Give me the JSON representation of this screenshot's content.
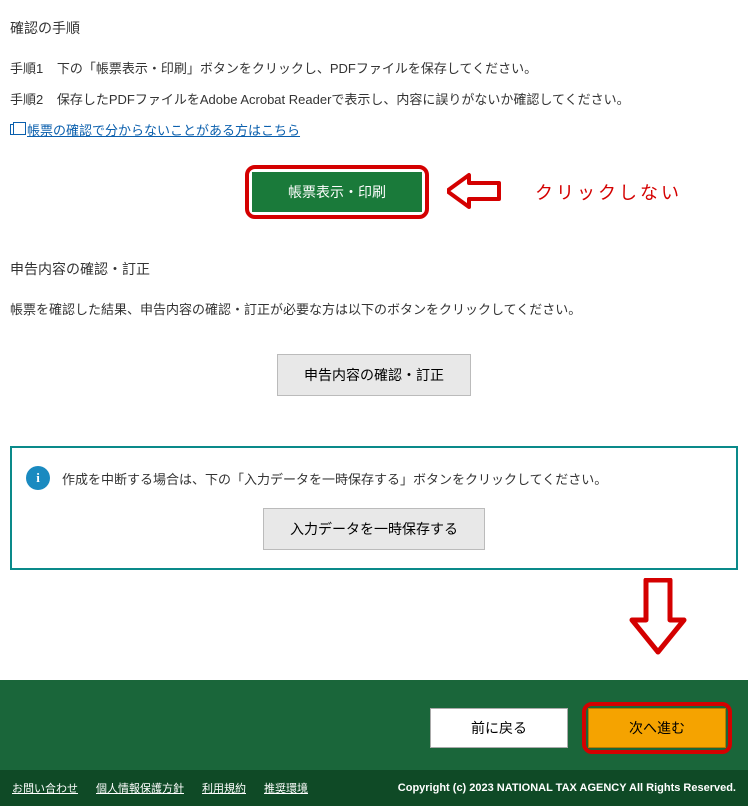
{
  "section1": {
    "title": "確認の手順",
    "step1_label": "手順1",
    "step1_text": "下の「帳票表示・印刷」ボタンをクリックし、PDFファイルを保存してください。",
    "step2_label": "手順2",
    "step2_text": "保存したPDFファイルをAdobe Acrobat Readerで表示し、内容に誤りがないか確認してください。",
    "help_link": "帳票の確認で分からないことがある方はこちら",
    "print_button": "帳票表示・印刷",
    "red_note": "クリックしない"
  },
  "section2": {
    "title": "申告内容の確認・訂正",
    "desc": "帳票を確認した結果、申告内容の確認・訂正が必要な方は以下のボタンをクリックしてください。",
    "button": "申告内容の確認・訂正"
  },
  "info_box": {
    "icon": "i",
    "text": "作成を中断する場合は、下の「入力データを一時保存する」ボタンをクリックしてください。",
    "button": "入力データを一時保存する"
  },
  "nav": {
    "back": "前に戻る",
    "next": "次へ進む"
  },
  "footer": {
    "links": [
      "お問い合わせ",
      "個人情報保護方針",
      "利用規約",
      "推奨環境"
    ],
    "copyright": "Copyright (c) 2023 NATIONAL TAX AGENCY All Rights Reserved."
  },
  "colors": {
    "red": "#d40000",
    "green_btn": "#1a7a3a",
    "green_bar": "#1a663a",
    "footer": "#0f4a26",
    "orange": "#f5a300",
    "teal": "#0a8a8a",
    "link": "#0a5fad"
  }
}
